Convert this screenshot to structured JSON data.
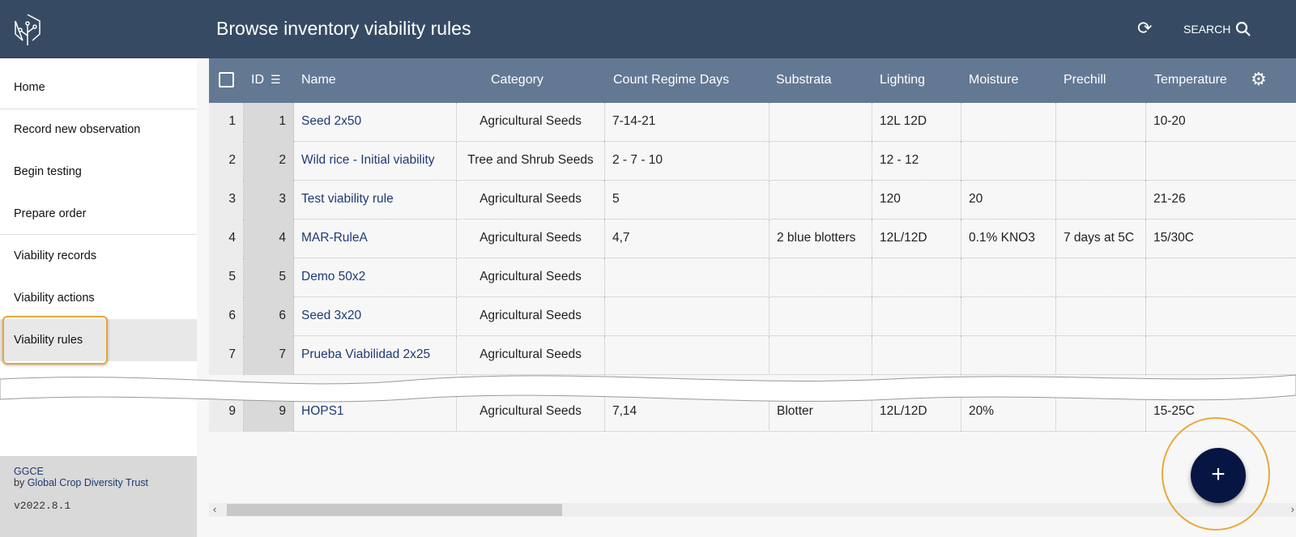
{
  "header": {
    "title": "Browse inventory viability rules",
    "search_label": "SEARCH",
    "icons": [
      "tree-logo-icon",
      "refresh-icon",
      "search-icon"
    ]
  },
  "sidebar": {
    "items": [
      {
        "label": "Home"
      },
      {
        "label": "Record new observation"
      },
      {
        "label": "Begin testing"
      },
      {
        "label": "Prepare order"
      },
      {
        "label": "Viability records"
      },
      {
        "label": "Viability actions"
      },
      {
        "label": "Viability rules",
        "selected": true
      }
    ],
    "footer": {
      "app": "GGCE",
      "by": "by ",
      "org": "Global Crop Diversity Trust",
      "version": "v2022.8.1"
    }
  },
  "table": {
    "columns": [
      "ID",
      "Name",
      "Category",
      "Count Regime Days",
      "Substrata",
      "Lighting",
      "Moisture",
      "Prechill",
      "Temperature"
    ],
    "rows": [
      [
        "1",
        "1",
        "Seed 2x50",
        "Agricultural Seeds",
        "7-14-21",
        "",
        "12L 12D",
        "",
        "",
        "10-20"
      ],
      [
        "2",
        "2",
        "Wild rice - Initial viability",
        "Tree and Shrub Seeds",
        "2 - 7 - 10",
        "",
        "12 - 12",
        "",
        "",
        ""
      ],
      [
        "3",
        "3",
        "Test viability rule",
        "Agricultural Seeds",
        "5",
        "",
        "120",
        "20",
        "",
        "21-26"
      ],
      [
        "4",
        "4",
        "MAR-RuleA",
        "Agricultural Seeds",
        "4,7",
        "2 blue blotters",
        "12L/12D",
        "0.1% KNO3",
        "7 days at 5C",
        "15/30C"
      ],
      [
        "5",
        "5",
        "Demo 50x2",
        "Agricultural Seeds",
        "",
        "",
        "",
        "",
        "",
        ""
      ],
      [
        "6",
        "6",
        "Seed 3x20",
        "Agricultural Seeds",
        "",
        "",
        "",
        "",
        "",
        ""
      ],
      [
        "7",
        "7",
        "Prueba Viabilidad 2x25",
        "Agricultural Seeds",
        "",
        "",
        "",
        "",
        "",
        ""
      ],
      [
        "9",
        "9",
        "HOPS1",
        "Agricultural Seeds",
        "7,14",
        "Blotter",
        "12L/12D",
        "20%",
        "",
        "15-25C"
      ]
    ]
  },
  "fab": {
    "label": "+"
  },
  "colors": {
    "header": "#364b63",
    "table_header": "#637892",
    "link": "#1f3a73",
    "fab": "#061542",
    "highlight": "#e8a838"
  }
}
